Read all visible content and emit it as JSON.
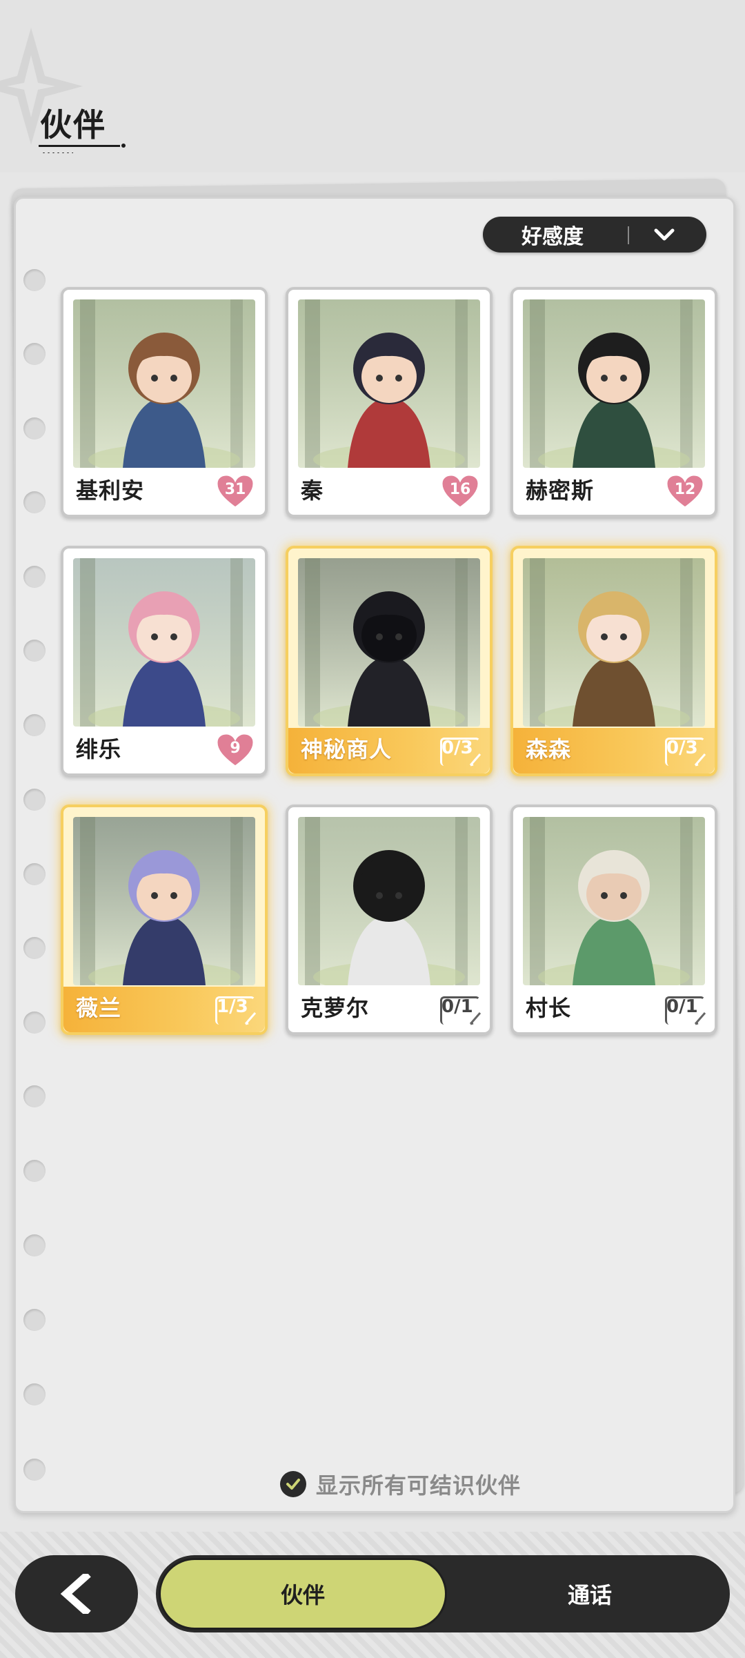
{
  "header": {
    "title": "伙伴"
  },
  "sort": {
    "label": "好感度"
  },
  "cards": [
    {
      "name": "基利安",
      "badge_type": "heart",
      "badge": "31",
      "highlight": false,
      "palette": {
        "bg": "#9fb08a",
        "hair": "#8a5a3a",
        "coat": "#3d5a8a",
        "skin": "#f4d6c0"
      }
    },
    {
      "name": "秦",
      "badge_type": "heart",
      "badge": "16",
      "highlight": false,
      "palette": {
        "bg": "#9fb08a",
        "hair": "#2a2a3a",
        "coat": "#b03a3a",
        "skin": "#f4d6c0"
      }
    },
    {
      "name": "赫密斯",
      "badge_type": "heart",
      "badge": "12",
      "highlight": false,
      "palette": {
        "bg": "#9fb08a",
        "hair": "#1e1e1e",
        "coat": "#2f4f3f",
        "skin": "#f4d6c0"
      }
    },
    {
      "name": "绯乐",
      "badge_type": "heart",
      "badge": "9",
      "highlight": false,
      "palette": {
        "bg": "#a7b8b0",
        "hair": "#e8a0b4",
        "coat": "#3c4a8a",
        "skin": "#f7e0d2"
      }
    },
    {
      "name": "神秘商人",
      "badge_type": "progress",
      "badge": "0/3",
      "highlight": true,
      "palette": {
        "bg": "#7d8a80",
        "hair": "#1a1a1f",
        "coat": "#222228",
        "skin": "#101014"
      }
    },
    {
      "name": "森森",
      "badge_type": "progress",
      "badge": "0/3",
      "highlight": true,
      "palette": {
        "bg": "#9fb08a",
        "hair": "#d9b56a",
        "coat": "#6f5030",
        "skin": "#f7e0d2"
      }
    },
    {
      "name": "薇兰",
      "badge_type": "progress",
      "badge": "1/3",
      "highlight": true,
      "palette": {
        "bg": "#7f9088",
        "hair": "#9a98d8",
        "coat": "#343c6a",
        "skin": "#f4d6c0"
      }
    },
    {
      "name": "克萝尔",
      "badge_type": "progress",
      "badge": "0/1",
      "highlight": false,
      "palette": {
        "bg": "#a5b496",
        "hair": "#1a1a1a",
        "coat": "#e8e8e8",
        "skin": "#1a1a1a"
      }
    },
    {
      "name": "村长",
      "badge_type": "progress",
      "badge": "0/1",
      "highlight": false,
      "palette": {
        "bg": "#9fb08a",
        "hair": "#e8e4d8",
        "coat": "#5c9a6a",
        "skin": "#e9cbb4"
      }
    }
  ],
  "show_all": {
    "label": "显示所有可结识伙伴",
    "checked": true
  },
  "nav": {
    "tab_active": "伙伴",
    "tab_inactive": "通话"
  },
  "colors": {
    "accent": "#ced575",
    "highlight": "#f6cf60",
    "heart": "#e07f96"
  }
}
